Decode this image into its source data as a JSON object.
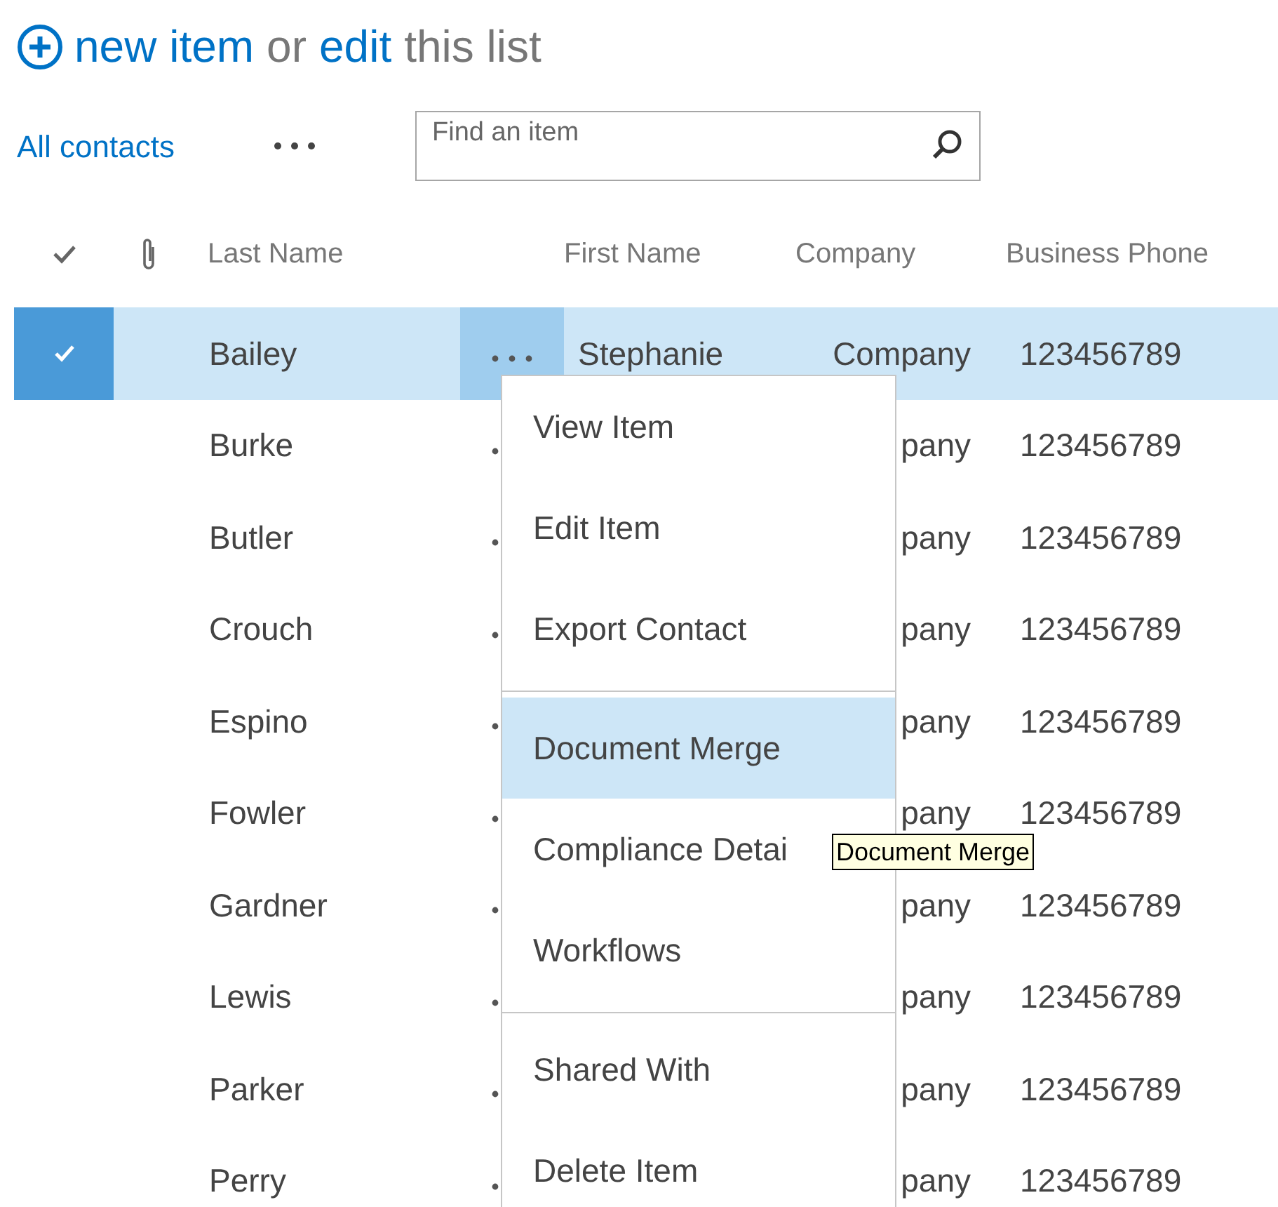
{
  "header": {
    "parts": [
      {
        "text": "new item",
        "kind": "link"
      },
      {
        "text": "or",
        "kind": "plain"
      },
      {
        "text": "edit",
        "kind": "link"
      },
      {
        "text": "this list",
        "kind": "plain"
      }
    ]
  },
  "views": {
    "current": "All contacts"
  },
  "search": {
    "placeholder": "Find an item"
  },
  "table": {
    "columns": [
      "Last Name",
      "First Name",
      "Company",
      "Business Phone"
    ],
    "rows": [
      {
        "last_name": "Bailey",
        "first_name": "Stephanie",
        "company": "Company",
        "phone": "123456789",
        "selected": true
      },
      {
        "last_name": "Burke",
        "company": "pany",
        "phone": "123456789",
        "selected": false
      },
      {
        "last_name": "Butler",
        "company": "pany",
        "phone": "123456789",
        "selected": false
      },
      {
        "last_name": "Crouch",
        "company": "pany",
        "phone": "123456789",
        "selected": false
      },
      {
        "last_name": "Espino",
        "company": "pany",
        "phone": "123456789",
        "selected": false
      },
      {
        "last_name": "Fowler",
        "company": "pany",
        "phone": "123456789",
        "selected": false
      },
      {
        "last_name": "Gardner",
        "company": "pany",
        "phone": "123456789",
        "selected": false
      },
      {
        "last_name": "Lewis",
        "company": "pany",
        "phone": "123456789",
        "selected": false
      },
      {
        "last_name": "Parker",
        "company": "pany",
        "phone": "123456789",
        "selected": false
      },
      {
        "last_name": "Perry",
        "company": "pany",
        "phone": "123456789",
        "selected": false
      }
    ]
  },
  "context_menu": {
    "groups": [
      [
        {
          "label": "View Item",
          "selected": false
        },
        {
          "label": "Edit Item",
          "selected": false
        },
        {
          "label": "Export Contact",
          "selected": false
        }
      ],
      [
        {
          "label": "Document Merge",
          "selected": true
        },
        {
          "label": "Compliance Detai",
          "selected": false
        },
        {
          "label": "Workflows",
          "selected": false
        }
      ],
      [
        {
          "label": "Shared With",
          "selected": false
        },
        {
          "label": "Delete Item",
          "selected": false
        }
      ]
    ]
  },
  "tooltip": {
    "text": "Document Merge"
  }
}
